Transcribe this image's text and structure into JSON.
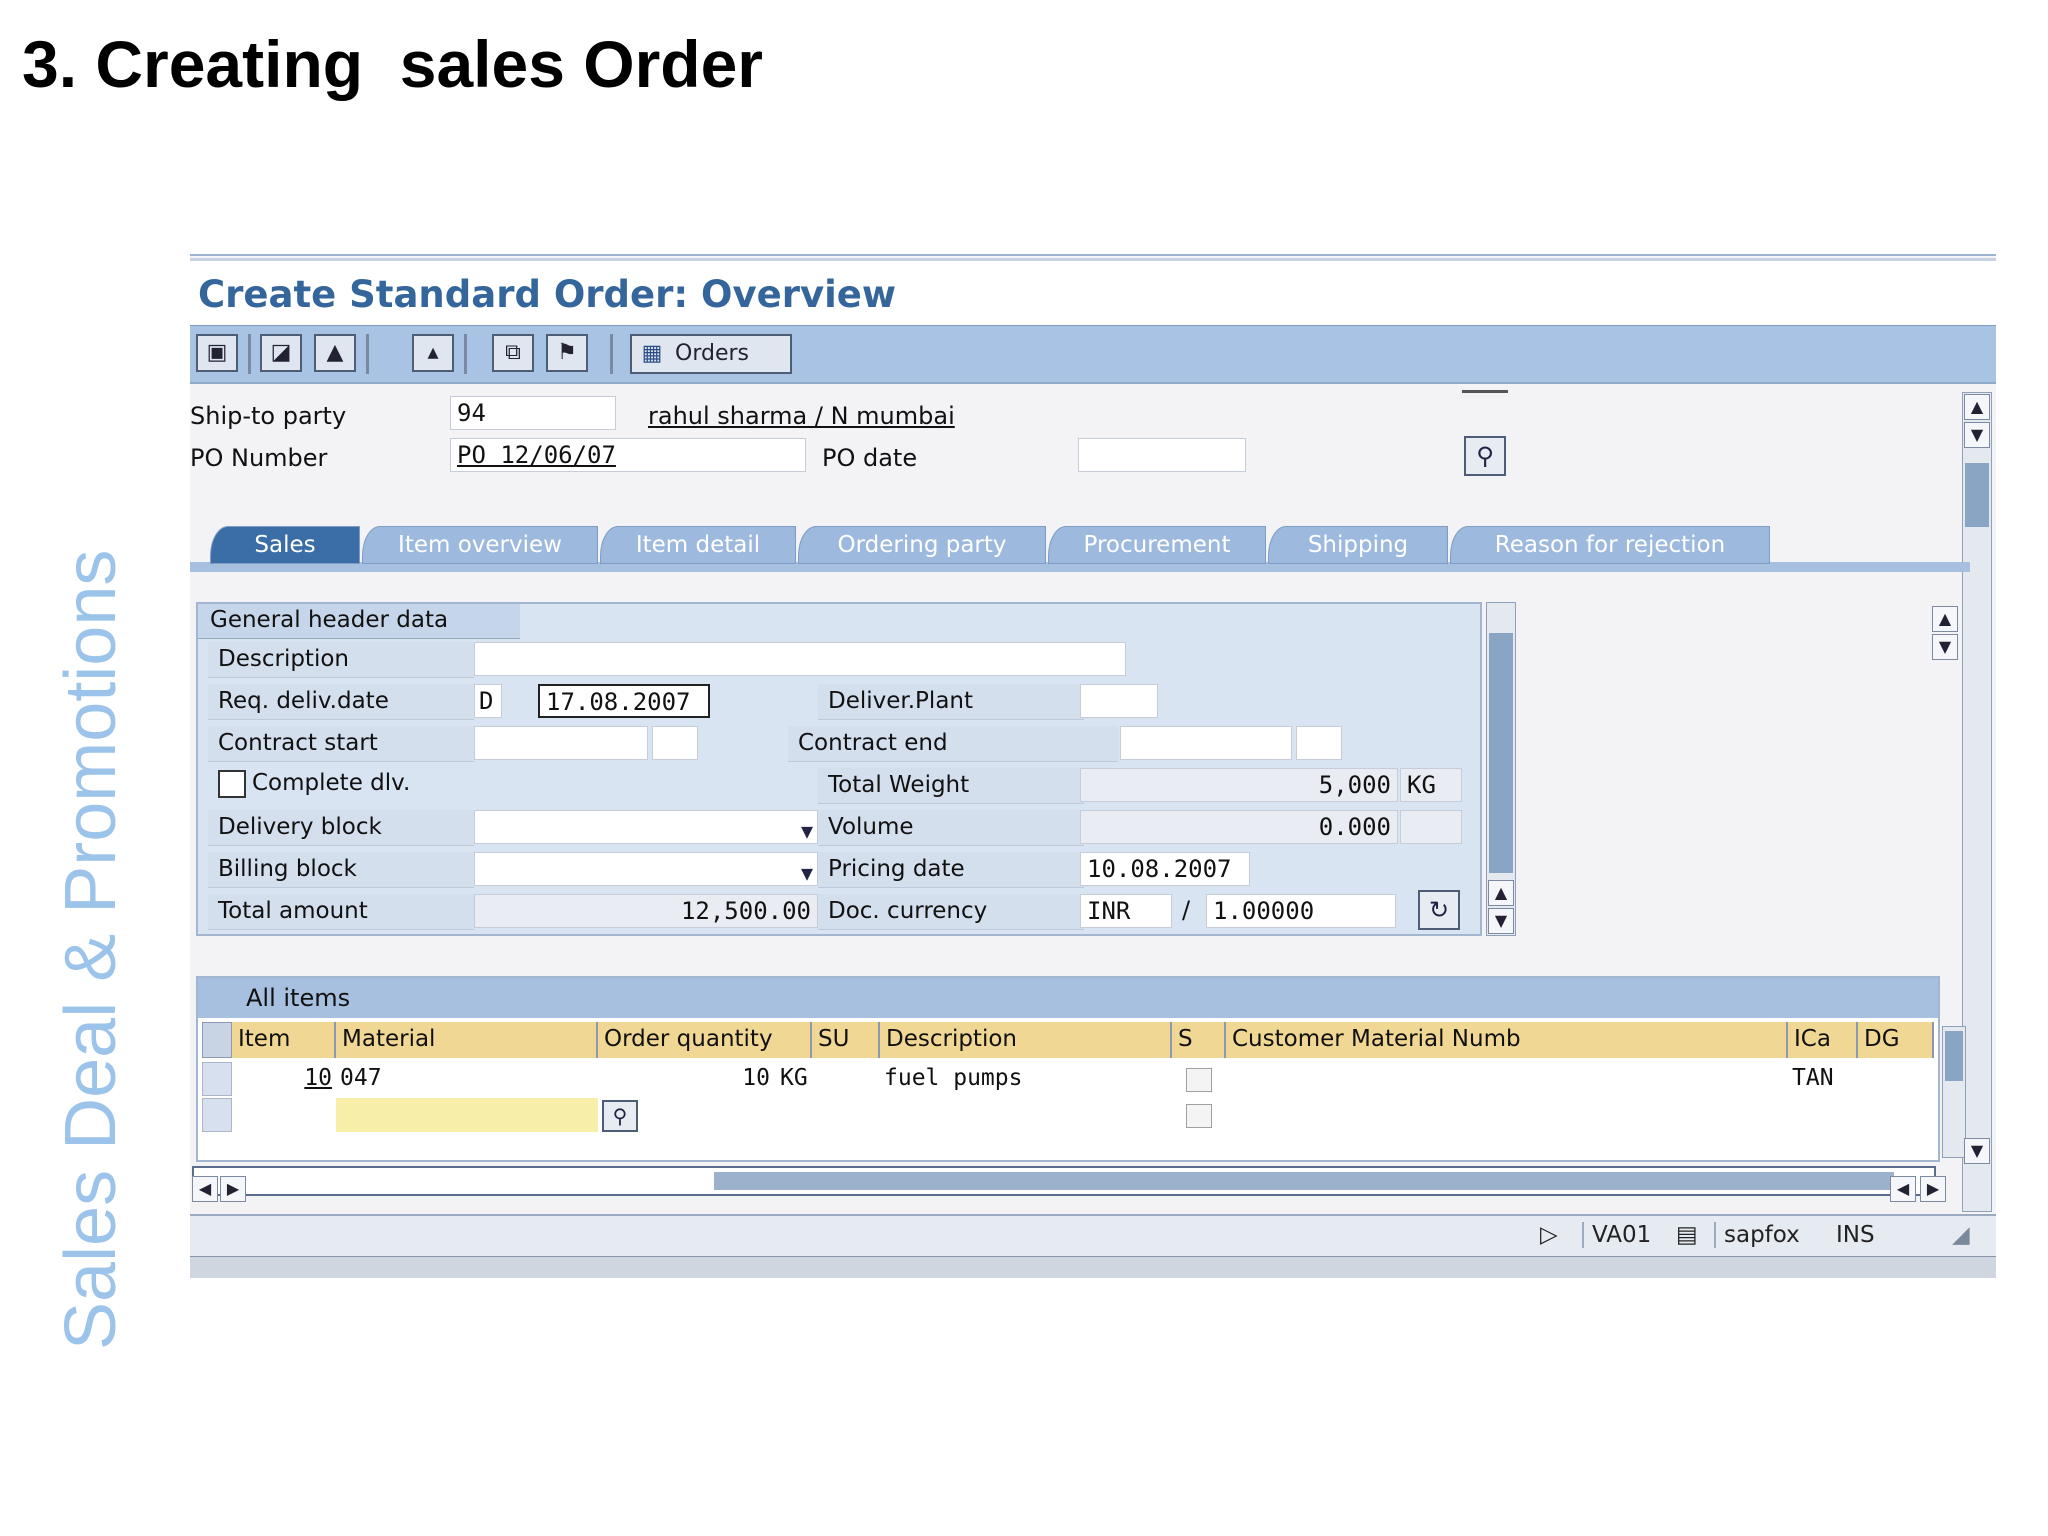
{
  "slide": {
    "title": "3. Creating  sales Order",
    "side_text": "Sales Deal & Promotions"
  },
  "window": {
    "title": "Create Standard Order: Overview",
    "toolbar": {
      "orders_label": "Orders"
    }
  },
  "header": {
    "ship_to_label": "Ship-to party",
    "ship_to_value": "94",
    "ship_to_name": "rahul sharma / N mumbai",
    "po_number_label": "PO Number",
    "po_number_value": "PO 12/06/07",
    "po_date_label": "PO date"
  },
  "tabs": [
    "Sales",
    "Item overview",
    "Item detail",
    "Ordering party",
    "Procurement",
    "Shipping",
    "Reason for rejection"
  ],
  "general_header": {
    "section_title": "General header data",
    "description_label": "Description",
    "req_deliv_date_label": "Req. deliv.date",
    "req_deliv_date_type": "D",
    "req_deliv_date_value": "17.08.2007",
    "deliver_plant_label": "Deliver.Plant",
    "contract_start_label": "Contract start",
    "contract_end_label": "Contract end",
    "complete_dlv_label": "Complete dlv.",
    "total_weight_label": "Total Weight",
    "total_weight_value": "5,000",
    "total_weight_unit": "KG",
    "delivery_block_label": "Delivery block",
    "volume_label": "Volume",
    "volume_value": "0.000",
    "billing_block_label": "Billing block",
    "pricing_date_label": "Pricing date",
    "pricing_date_value": "10.08.2007",
    "total_amount_label": "Total amount",
    "total_amount_value": "12,500.00",
    "doc_currency_label": "Doc. currency",
    "doc_currency_value": "INR",
    "exchange_rate_value": "1.00000"
  },
  "items": {
    "section_title": "All items",
    "columns": [
      "Item",
      "Material",
      "Order quantity",
      "SU",
      "Description",
      "S",
      "Customer Material Numb",
      "ICa",
      "DG"
    ],
    "rows": [
      {
        "item": "10",
        "material": "047",
        "quantity": "10",
        "su": "KG",
        "description": "fuel pumps",
        "item_category": "TAN"
      }
    ]
  },
  "status_bar": {
    "transaction": "VA01",
    "server": "sapfox",
    "mode": "INS"
  }
}
